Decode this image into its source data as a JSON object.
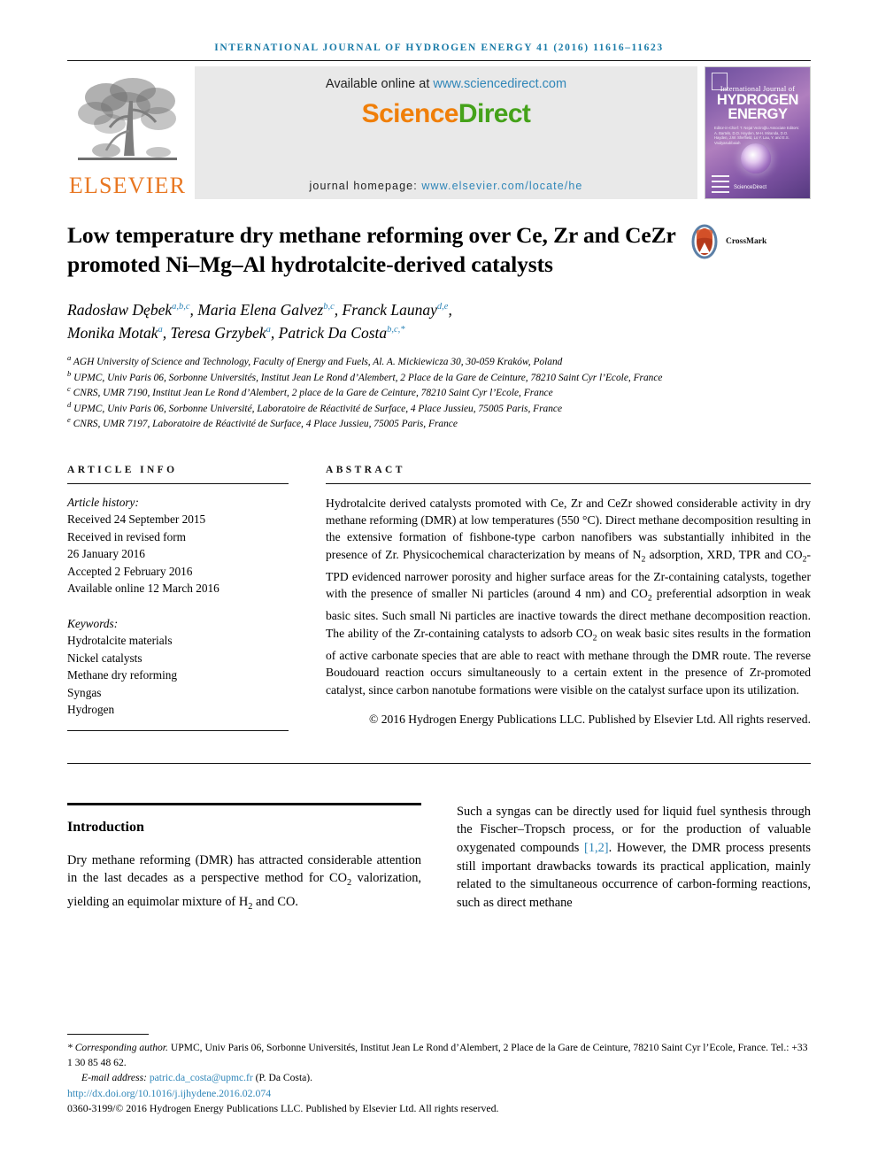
{
  "running_head": "International Journal of Hydrogen Energy 41 (2016) 11616–11623",
  "masthead": {
    "publisher_name": "ELSEVIER",
    "available_prefix": "Available online at ",
    "available_url": "www.sciencedirect.com",
    "sciencedirect_science": "Science",
    "sciencedirect_direct": "Direct",
    "homepage_label": "journal homepage: ",
    "homepage_url": "www.elsevier.com/locate/he",
    "cover": {
      "line_small": "International Journal of",
      "line_big_1": "HYDROGEN",
      "line_big_2": "ENERGY",
      "editors": "Editor-in-Chief: T. Nejat Veziroğlu    Associate Editors: A. Bartels, D.O. Hayden, M-H. Miranda, D.O. Hayden, J.W. Sheffield, Lo Y. Lau, Y. and E.S. Vaidyasubbaiah",
      "sciencedirect_mark": "ScienceDirect"
    }
  },
  "article": {
    "title": "Low temperature dry methane reforming over Ce, Zr and CeZr promoted Ni–Mg–Al hydrotalcite-derived catalysts",
    "crossmark_label": "CrossMark",
    "authors": [
      {
        "name": "Radosław Dębek",
        "marks": "a,b,c",
        "sep": ", "
      },
      {
        "name": "Maria Elena Galvez",
        "marks": "b,c",
        "sep": ", "
      },
      {
        "name": "Franck Launay",
        "marks": "d,e",
        "sep": ", "
      },
      {
        "name": "Monika Motak",
        "marks": "a",
        "sep": ", "
      },
      {
        "name": "Teresa Grzybek",
        "marks": "a",
        "sep": ", "
      },
      {
        "name": "Patrick Da Costa",
        "marks": "b,c,*",
        "sep": ""
      }
    ],
    "affiliations": [
      {
        "mark": "a",
        "text": "AGH University of Science and Technology, Faculty of Energy and Fuels, Al. A. Mickiewicza 30, 30-059 Kraków, Poland"
      },
      {
        "mark": "b",
        "text": "UPMC, Univ Paris 06, Sorbonne Universités, Institut Jean Le Rond d’Alembert, 2 Place de la Gare de Ceinture, 78210 Saint Cyr l’Ecole, France"
      },
      {
        "mark": "c",
        "text": "CNRS, UMR 7190, Institut Jean Le Rond d’Alembert, 2 place de la Gare de Ceinture, 78210 Saint Cyr l’Ecole, France"
      },
      {
        "mark": "d",
        "text": "UPMC, Univ Paris 06, Sorbonne Université, Laboratoire de Réactivité de Surface, 4 Place Jussieu, 75005 Paris, France"
      },
      {
        "mark": "e",
        "text": "CNRS, UMR 7197, Laboratoire de Réactivité de Surface, 4 Place Jussieu, 75005 Paris, France"
      }
    ]
  },
  "article_info": {
    "heading": "ARTICLE INFO",
    "history_label": "Article history:",
    "history": [
      "Received 24 September 2015",
      "Received in revised form",
      "26 January 2016",
      "Accepted 2 February 2016",
      "Available online 12 March 2016"
    ],
    "keywords_label": "Keywords:",
    "keywords": [
      "Hydrotalcite materials",
      "Nickel catalysts",
      "Methane dry reforming",
      "Syngas",
      "Hydrogen"
    ]
  },
  "abstract": {
    "heading": "ABSTRACT",
    "copyright": "© 2016 Hydrogen Energy Publications LLC. Published by Elsevier Ltd. All rights reserved."
  },
  "body": {
    "introduction_heading": "Introduction",
    "citation_link": "[1,2]"
  },
  "footer": {
    "corresponding_marker": "*",
    "corresponding_label": "Corresponding author.",
    "corresponding_address": " UPMC, Univ Paris 06, Sorbonne Universités, Institut Jean Le Rond d’Alembert, 2 Place de la Gare de Ceinture, 78210 Saint Cyr l’Ecole, France. Tel.: +33 1 30 85 48 62.",
    "email_label": "E-mail address: ",
    "email": "patric.da_costa@upmc.fr",
    "email_suffix": " (P. Da Costa).",
    "doi": "http://dx.doi.org/10.1016/j.ijhydene.2016.02.074",
    "issn_line": "0360-3199/© 2016 Hydrogen Energy Publications LLC. Published by Elsevier Ltd. All rights reserved."
  },
  "colors": {
    "link": "#2f86b8",
    "running_head": "#1a7ba8",
    "elsevier_orange": "#e87722",
    "sciencedirect_green": "#45a21a"
  }
}
